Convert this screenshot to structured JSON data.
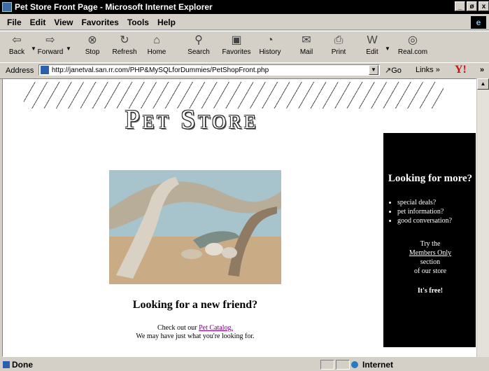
{
  "window": {
    "title": "Pet Store Front Page - Microsoft Internet Explorer",
    "controls": [
      "_",
      "ø",
      "x"
    ]
  },
  "menu": [
    "File",
    "Edit",
    "View",
    "Favorites",
    "Tools",
    "Help"
  ],
  "toolbar": {
    "back": "Back",
    "forward": "Forward",
    "stop": "Stop",
    "refresh": "Refresh",
    "home": "Home",
    "search": "Search",
    "favorites": "Favorites",
    "history": "History",
    "mail": "Mail",
    "print": "Print",
    "edit": "Edit",
    "realcom": "Real.com"
  },
  "address": {
    "label": "Address",
    "url": "http://janetval.san.rr.com/PHP&MySQLforDummies/PetShopFront.php",
    "go": "Go",
    "links": "Links »",
    "more": "»"
  },
  "page": {
    "store_title": "Pet Store",
    "sidebar": {
      "heading": "Looking for more?",
      "items": [
        "special deals?",
        "pet information?",
        "good conversation?"
      ],
      "try_prefix": "Try the",
      "members_link": "Members Only",
      "try_suffix_1": "section",
      "try_suffix_2": "of our store",
      "free": "It's free!"
    },
    "friend_heading": "Looking for a new friend?",
    "check_prefix": "Check out our ",
    "catalog_link": "Pet Catalog.",
    "check_line2": "We may have just what you're looking for."
  },
  "status": {
    "text": "Done",
    "zone": "Internet"
  }
}
